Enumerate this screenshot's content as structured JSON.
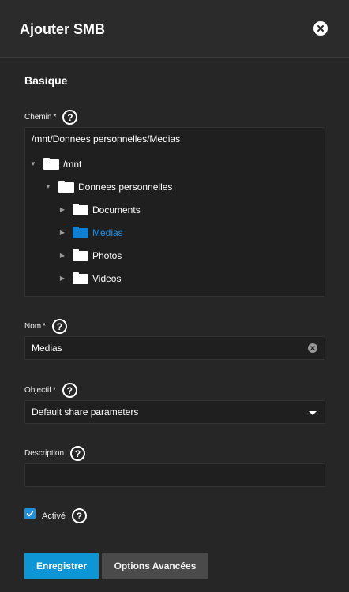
{
  "header": {
    "title": "Ajouter SMB",
    "close_icon": "close-icon"
  },
  "section": {
    "title": "Basique"
  },
  "path": {
    "label": "Chemin",
    "required_mark": "*",
    "value": "/mnt/Donnees personnelles/Medias",
    "tree": {
      "root": "/mnt",
      "child": "Donnees personnelles",
      "items": [
        "Documents",
        "Medias",
        "Photos",
        "Videos"
      ],
      "selected": "Medias"
    }
  },
  "name": {
    "label": "Nom",
    "required_mark": "*",
    "value": "Medias"
  },
  "purpose": {
    "label": "Objectif",
    "required_mark": "*",
    "value": "Default share parameters"
  },
  "description": {
    "label": "Description",
    "value": ""
  },
  "enabled": {
    "label": "Activé",
    "checked": true
  },
  "help_glyph": "?",
  "buttons": {
    "save": "Enregistrer",
    "advanced": "Options Avancées"
  },
  "colors": {
    "accent": "#0e95d6",
    "selected_folder": "#0f7fd3",
    "background": "#262626"
  }
}
